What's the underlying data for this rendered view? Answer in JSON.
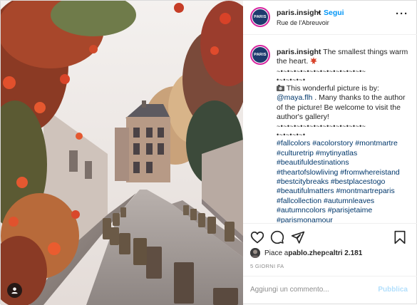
{
  "post": {
    "username": "paris.insight",
    "dot": "•",
    "follow_label": "Segui",
    "location": "Rue de l'Abreuvoir",
    "more_label": "···",
    "avatar_text": "PARIS"
  },
  "caption": {
    "username": "paris.insight",
    "intro": " The smallest things warm the heart. ",
    "separator": "~•~•~•~•~•~•~•~•~•~•~•~•~•~",
    "separator_short": "•~•~•~•~•",
    "credit_prefix": " This wonderful picture is by: ",
    "mention": "@maya.flh",
    "credit_suffix": " . Many thanks to the author of the picture! Be welcome to visit the author's gallery!",
    "hashtags": "#fallcolors #acolorstory #montmartre #culturetrip #mytinyatlas #beautifuldestinations #theartofslowliving #fromwhereistand #bestcitybreaks #bestplacestogo #beautifulmatters #montmartreparis #fallcollection #autumnleaves #autumncolors #parisjetaime #parismonamour"
  },
  "actions": {
    "like_icon": "heart-icon",
    "comment_icon": "comment-icon",
    "share_icon": "share-icon",
    "save_icon": "bookmark-icon"
  },
  "likes": {
    "prefix": "Piace a ",
    "user": "pablo.zhep",
    "middle": " e ",
    "others": "altri 2.181"
  },
  "timestamp": "5 GIORNI FA",
  "comment": {
    "placeholder": "Aggiungi un commento...",
    "publish_label": "Pubblica"
  },
  "colors": {
    "link_blue": "#0095f6",
    "hashtag_blue": "#00376b",
    "publish_disabled": "#b2dffc",
    "muted_gray": "#8e8e8e"
  }
}
